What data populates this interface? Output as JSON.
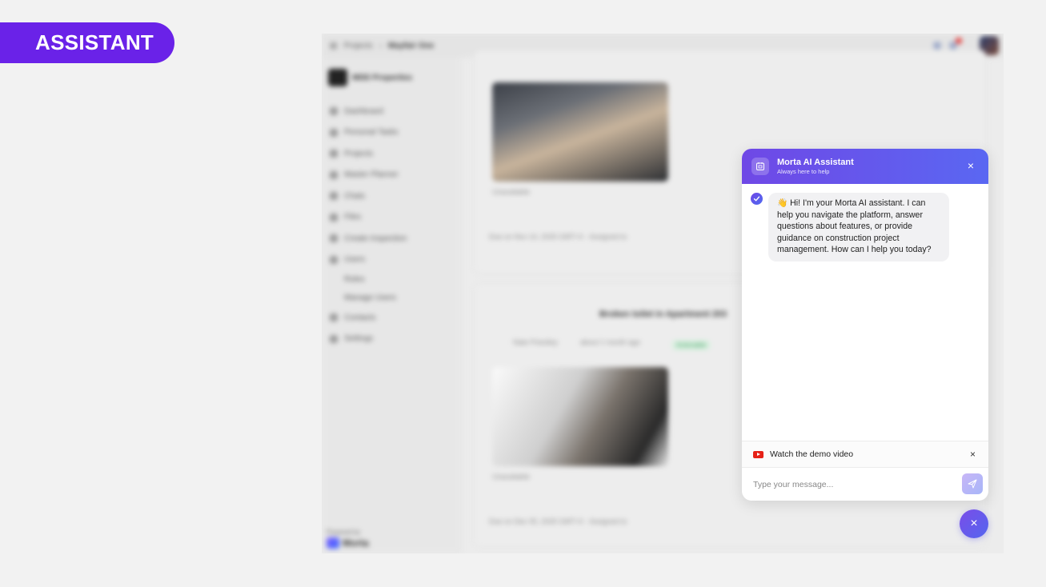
{
  "tag": {
    "label": "ASSISTANT"
  },
  "background_app": {
    "breadcrumb": [
      "Projects",
      "Mayfair One"
    ],
    "org_name": "MDD Properties",
    "nav": [
      "Dashboard",
      "Personal Tasks",
      "Projects",
      "Master Planner",
      "Chats",
      "Files",
      "Create Inspection",
      "Users",
      "Roles",
      "Manage Users",
      "Contacts",
      "Settings"
    ],
    "powered_by": "Powered by",
    "brand": "Morta",
    "card2_title": "Broken toilet in Apartment 203",
    "card2_author": "Nate Priestley",
    "card2_time": "about 1 month ago",
    "status": "Actionable",
    "card1_due": "Due on Nov 14, 2025 GMT+0 · Assigned to",
    "card2_due": "Due on Dec 05, 2025 GMT+0 · Assigned to",
    "unavailable": "Unavailable"
  },
  "assistant": {
    "title": "Morta AI Assistant",
    "subtitle": "Always here to help",
    "message": "👋 Hi! I'm your Morta AI assistant. I can help you navigate the platform, answer questions about features, or provide guidance on construction project management. How can I help you today?",
    "demo_label": "Watch the demo video",
    "input_placeholder": "Type your message...",
    "close_glyph": "×"
  },
  "colors": {
    "accent": "#6a22e8",
    "header_start": "#6f48e6",
    "header_end": "#5a67f2",
    "youtube": "#e62117"
  }
}
